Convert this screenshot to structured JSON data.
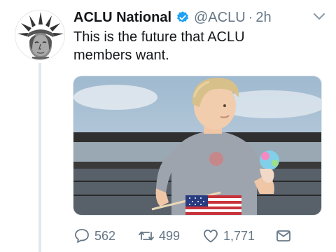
{
  "tweet": {
    "display_name": "ACLU National",
    "handle": "@ACLU",
    "separator": "·",
    "time": "2h",
    "text": "This is the future that ACLU\nmembers want.",
    "verified": true
  },
  "actions": {
    "replies": "562",
    "retweets": "499",
    "likes": "1,771"
  },
  "icons": {
    "reply": "reply-icon",
    "retweet": "retweet-icon",
    "like": "heart-icon",
    "dm": "mail-icon",
    "menu": "chevron-down-icon",
    "verified": "verified-badge-icon"
  },
  "colors": {
    "text": "#14171a",
    "muted": "#657786",
    "verified": "#1da1f2",
    "divider": "#e1e8ed"
  }
}
